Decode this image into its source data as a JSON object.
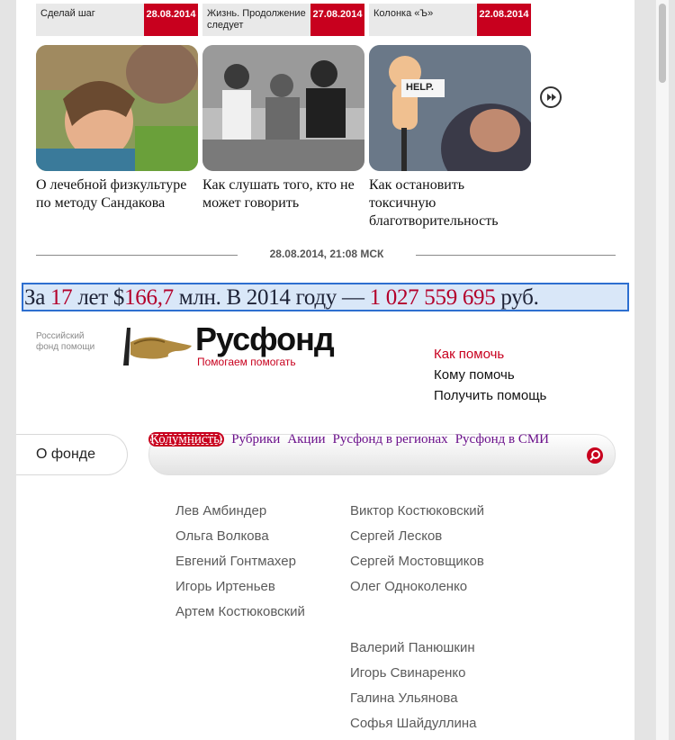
{
  "news_tabs": [
    {
      "title": "Сделай шаг",
      "date": "28.08.2014"
    },
    {
      "title": "Жизнь. Продолжение следует",
      "date": "27.08.2014"
    },
    {
      "title": "Колонка «Ъ»",
      "date": "22.08.2014"
    }
  ],
  "cards": [
    {
      "title": "О лечебной физкультуре по методу Сандакова"
    },
    {
      "title": "Как слушать того, кто не может говорить"
    },
    {
      "title": "Как остановить токсичную благотворительность"
    }
  ],
  "card_help_sign": "HELP.",
  "timestamp": "28.08.2014, 21:08 МСК",
  "banner": {
    "p1": "За ",
    "years": "17",
    "p2": " лет $",
    "amount": "166,7",
    "p3": " млн. В 20",
    "p3b": "1",
    "p3c": "4 году — ",
    "total": "1 027 559 695",
    "p4": " руб."
  },
  "logo": {
    "small_line1": "Российский",
    "small_line2": "фонд помощи",
    "brand": "Русфонд",
    "slogan": "Помогаем помогать"
  },
  "help_links": [
    "Как помочь",
    "Кому помочь",
    "Получить помощь"
  ],
  "about_button": "О фонде",
  "nav": [
    "Колумнисты",
    "Рубрики",
    "Акции",
    "Русфонд в регионах",
    "Русфонд в СМИ"
  ],
  "columnists_left": [
    "Лев Амбиндер",
    "Ольга Волкова",
    "Евгений Гонтмахер",
    "Игорь Иртеньев",
    "Артем Костюковский"
  ],
  "columnists_right_1": [
    "Виктор Костюковский",
    "Сергей Лесков",
    "Сергей Мостовщиков",
    "Олег Одноколенко"
  ],
  "columnists_right_2": [
    "Валерий Панюшкин",
    "Игорь Свинаренко",
    "Галина Ульянова",
    "Софья Шайдуллина"
  ],
  "colors": {
    "accent": "#c8001e",
    "nav_link": "#6a0f8a",
    "banner_bg": "#d9e7f8"
  }
}
